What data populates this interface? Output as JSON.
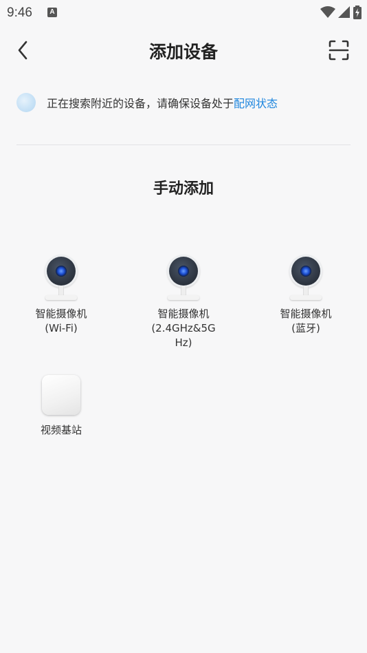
{
  "status_bar": {
    "time": "9:46",
    "icons": [
      "a-notification-icon",
      "wifi-icon",
      "cellular-signal-icon",
      "battery-charging-icon"
    ]
  },
  "app_bar": {
    "title": "添加设备",
    "back_icon": "chevron-left-icon",
    "scan_icon": "scan-icon"
  },
  "search": {
    "text": "正在搜索附近的设备，请确保设备处于",
    "link": "配网状态",
    "link_color": "#1e86de"
  },
  "manual": {
    "title": "手动添加",
    "devices": [
      {
        "line1": "智能摄像机",
        "line2": "(Wi-Fi)",
        "line3": ""
      },
      {
        "line1": "智能摄像机",
        "line2": "(2.4GHz&5G",
        "line3": "Hz)"
      },
      {
        "line1": "智能摄像机",
        "line2": "(蓝牙)",
        "line3": ""
      },
      {
        "line1": "视频基站",
        "line2": "",
        "line3": ""
      }
    ]
  }
}
